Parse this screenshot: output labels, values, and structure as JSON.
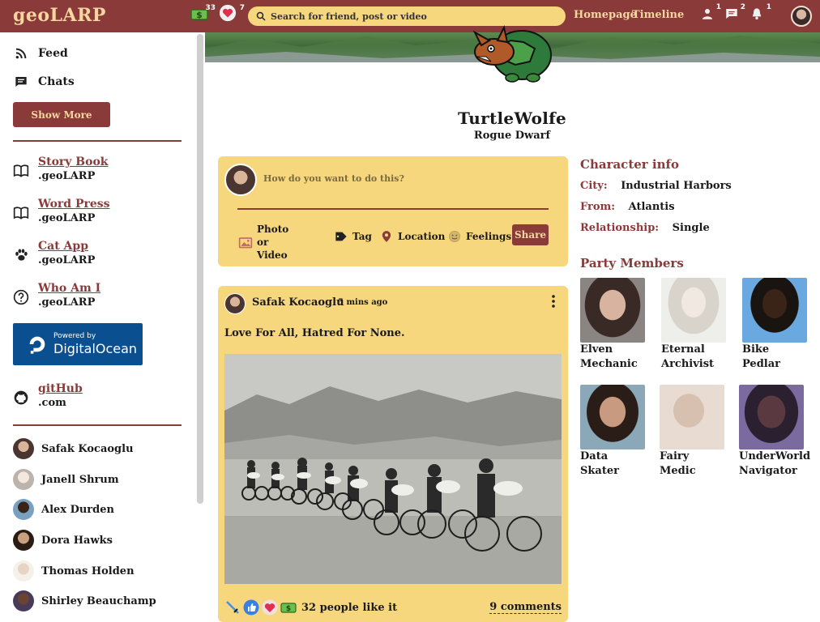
{
  "app": {
    "logo": "geoLARP"
  },
  "topbar": {
    "coins_count": "33",
    "hearts_count": "7",
    "search_placeholder": "Search for friend, post or video",
    "nav": [
      "Homepage",
      "Timeline"
    ],
    "friend_requests_count": "1",
    "messages_count": "2",
    "notifications_count": "1"
  },
  "sidebar": {
    "items": [
      {
        "label": "Feed",
        "icon": "rss-icon"
      },
      {
        "label": "Chats",
        "icon": "chat-icon"
      }
    ],
    "show_more": "Show More",
    "links": [
      {
        "title": "Story Book",
        "sub": ".geoLARP",
        "icon": "book-icon"
      },
      {
        "title": "Word Press",
        "sub": ".geoLARP",
        "icon": "book-icon"
      },
      {
        "title": "Cat App",
        "sub": ".geoLARP",
        "icon": "paw-icon"
      },
      {
        "title": "Who Am I",
        "sub": ".geoLARP",
        "icon": "question-icon"
      }
    ],
    "sponsor": {
      "powered": "Powered by",
      "brand": "DigitalOcean"
    },
    "github": {
      "title": "gitHub",
      "sub": ".com"
    },
    "friends": [
      "Safak Kocaoglu",
      "Janell Shrum",
      "Alex Durden",
      "Dora Hawks",
      "Thomas Holden",
      "Shirley Beauchamp"
    ]
  },
  "profile": {
    "name": "TurtleWolfe",
    "role": "Rogue Dwarf"
  },
  "composer": {
    "placeholder": "How do you want to do this?",
    "photo_label": "Photo or Video",
    "tag_label": "Tag",
    "location_label": "Location",
    "feelings_label": "Feelings",
    "share_label": "Share"
  },
  "post": {
    "author": "Safak Kocaoglu",
    "time": "5 mins ago",
    "text": "Love For All, Hatred For None.",
    "likes": "32 people like it",
    "comments": "9 comments"
  },
  "character_info": {
    "title": "Character info",
    "rows": [
      {
        "key": "City:",
        "value": "Industrial Harbors"
      },
      {
        "key": "From:",
        "value": "Atlantis"
      },
      {
        "key": "Relationship:",
        "value": "Single"
      }
    ]
  },
  "party": {
    "title": "Party Members",
    "members": [
      {
        "line1": "Elven",
        "line2": "Mechanic"
      },
      {
        "line1": "Eternal",
        "line2": "Archivist"
      },
      {
        "line1": "Bike",
        "line2": "Pedlar"
      },
      {
        "line1": "Data",
        "line2": "Skater"
      },
      {
        "line1": "Fairy",
        "line2": "Medic"
      },
      {
        "line1": "UnderWorld",
        "line2": "Navigator"
      }
    ]
  },
  "colors": {
    "brand": "#8b3a3a",
    "card": "#f7d77d",
    "accent_text": "#f6d6a0"
  }
}
